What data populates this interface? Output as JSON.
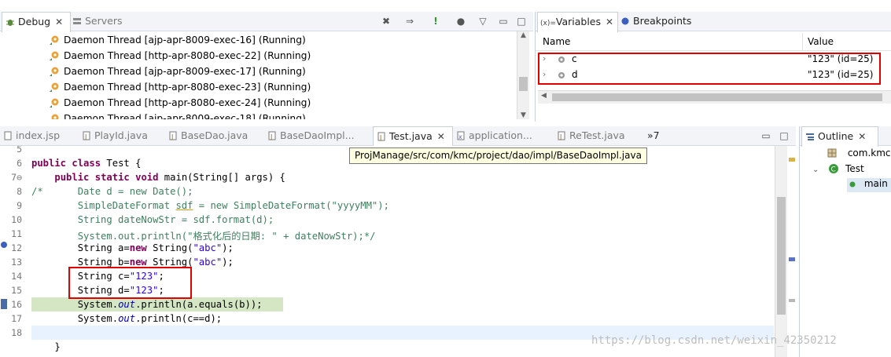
{
  "debug_view": {
    "tabs": [
      {
        "label": "Debug",
        "close": "✕"
      },
      {
        "label": "Servers"
      }
    ],
    "threads": [
      "Daemon Thread [ajp-apr-8009-exec-16] (Running)",
      "Daemon Thread [http-apr-8080-exec-22] (Running)",
      "Daemon Thread [ajp-apr-8009-exec-17] (Running)",
      "Daemon Thread [http-apr-8080-exec-23] (Running)",
      "Daemon Thread [http-apr-8080-exec-24] (Running)",
      "Daemon Thread [ajp-apr-8009-exec-18] (Running)"
    ]
  },
  "variables_view": {
    "tabs": [
      {
        "prefix": "(x)=",
        "label": "Variables",
        "close": "✕"
      },
      {
        "label": "Breakpoints"
      }
    ],
    "columns": {
      "name": "Name",
      "value": "Value"
    },
    "rows": [
      {
        "name": "c",
        "value": "\"123\" (id=25)"
      },
      {
        "name": "d",
        "value": "\"123\" (id=25)"
      }
    ]
  },
  "editor": {
    "tabs": [
      {
        "label": "index.jsp"
      },
      {
        "label": "PlayId.java"
      },
      {
        "label": "BaseDao.java"
      },
      {
        "label": "BaseDaoImpl..."
      },
      {
        "label": "Test.java",
        "close": "✕"
      },
      {
        "label": "application..."
      },
      {
        "label": "ReTest.java"
      },
      {
        "label": "»7"
      }
    ],
    "tooltip": "ProjManage/src/com/kmc/project/dao/impl/BaseDaoImpl.java",
    "line_numbers": [
      "5",
      "6",
      "7⊖",
      "8",
      "9",
      "10",
      "11",
      "12",
      "13",
      "14",
      "15",
      "16",
      "17",
      "18",
      ""
    ]
  },
  "outline_view": {
    "tab": {
      "label": "Outline",
      "close": "✕"
    },
    "items": [
      {
        "label": "com.kmc."
      },
      {
        "label": "Test"
      },
      {
        "label": "main"
      }
    ]
  },
  "watermark": "https://blog.csdn.net/weixin_42350212",
  "colors": {
    "highlight_line": "#d4e6c3",
    "red_box": "#e00000",
    "keyword": "#7f0055",
    "string": "#2a00ff",
    "comment": "#3f7f5f"
  }
}
